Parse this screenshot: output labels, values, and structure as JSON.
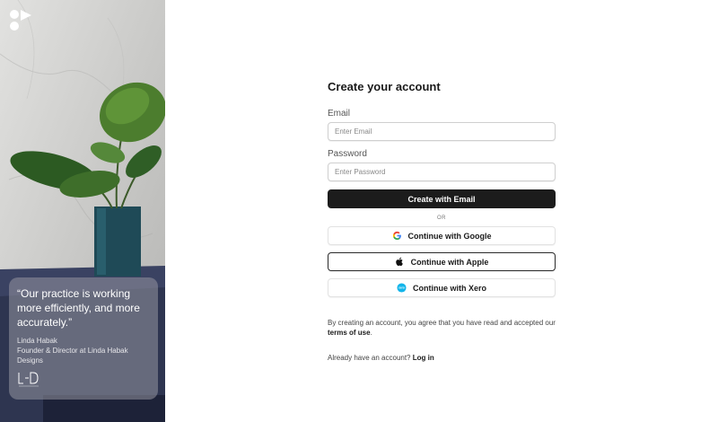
{
  "hero": {
    "quote": "“Our practice is working more efficiently, and more accurately.”",
    "author": "Linda Habak",
    "role": "Founder & Director at Linda Habak Designs",
    "logo_icon": "company-logo-icon",
    "partner_logo_icon": "lhd-logo-icon"
  },
  "form": {
    "title": "Create your account",
    "email_label": "Email",
    "email_placeholder": "Enter Email",
    "email_value": "",
    "password_label": "Password",
    "password_placeholder": "Enter Password",
    "password_value": "",
    "create_button": "Create with Email",
    "divider": "OR",
    "google_button": "Continue with Google",
    "apple_button": "Continue with Apple",
    "xero_button": "Continue with Xero",
    "terms_prefix": "By creating an account, you agree that you have read and accepted our",
    "terms_link": "terms of use",
    "terms_suffix": ".",
    "login_prompt": "Already have an account?",
    "login_link": "Log in"
  },
  "colors": {
    "primary_button": "#1c1c1c",
    "xero_blue": "#13b5ea"
  }
}
